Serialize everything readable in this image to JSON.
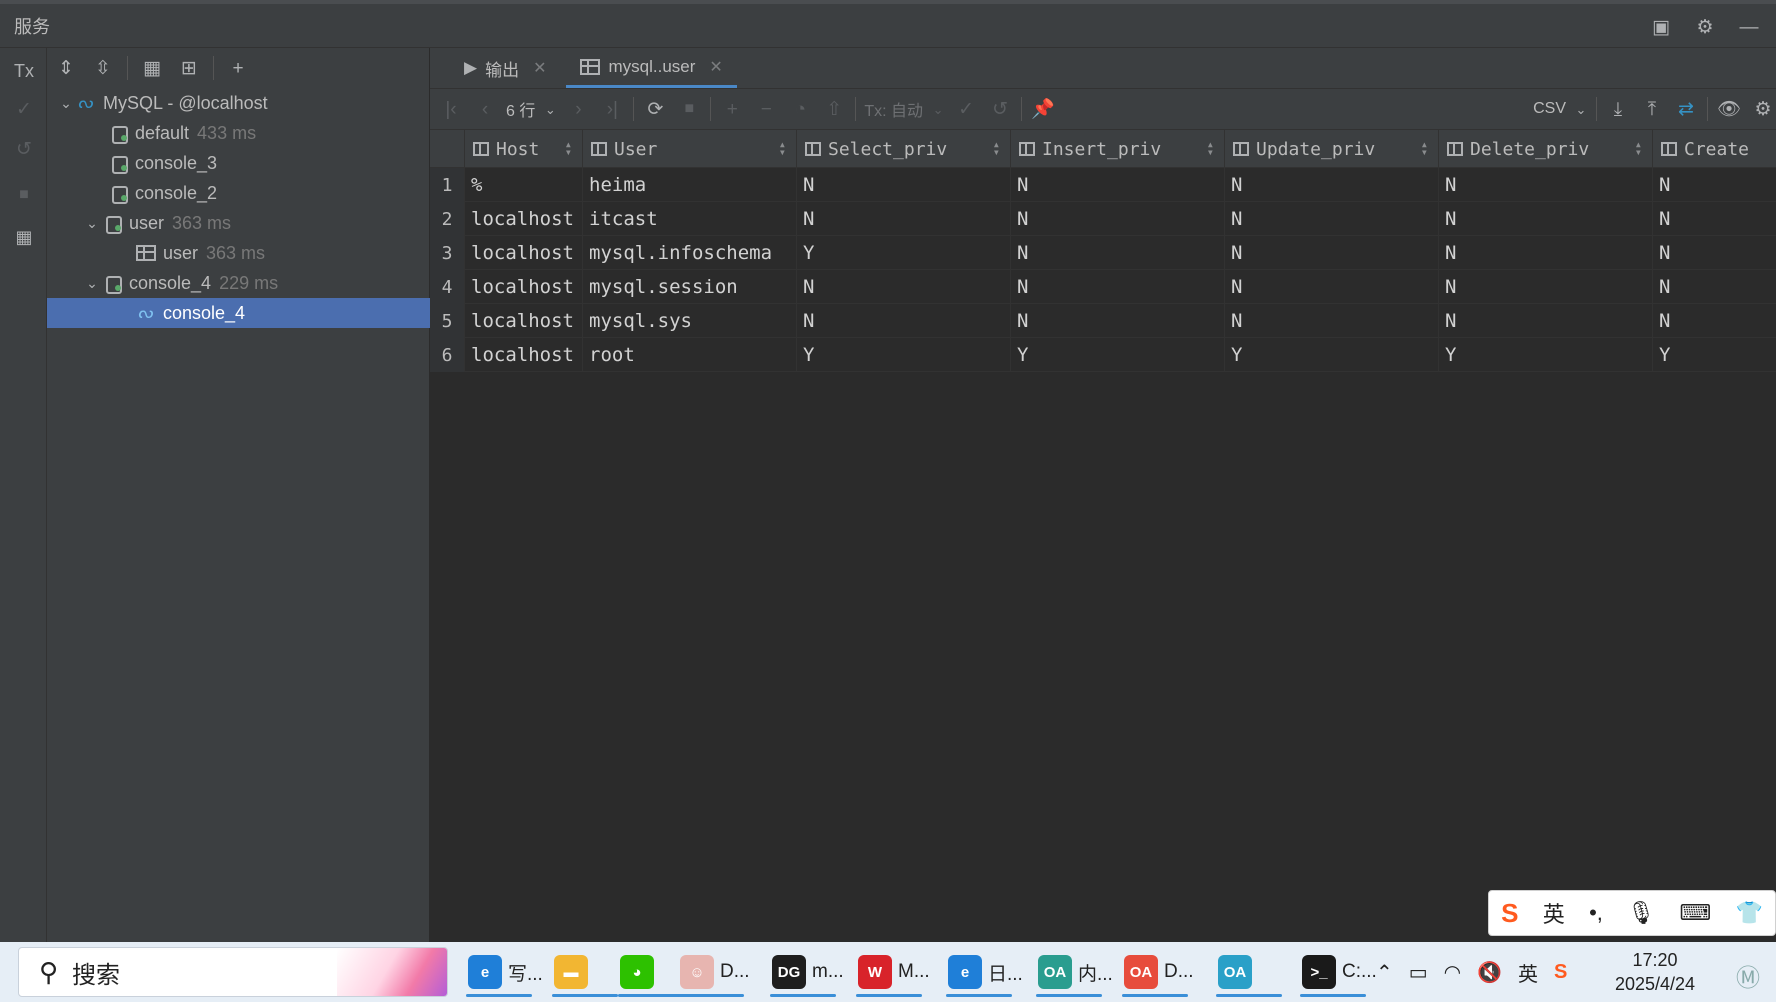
{
  "window": {
    "title": "服务"
  },
  "tree_toolbar": {
    "tx_label": "Tx"
  },
  "tree": [
    {
      "label": "MySQL - @localhost",
      "time": "",
      "icon": "mysql-dolphin-icon",
      "expanded": true
    },
    {
      "label": "default",
      "time": "433 ms",
      "icon": "session-icon"
    },
    {
      "label": "console_3",
      "time": "",
      "icon": "session-icon"
    },
    {
      "label": "console_2",
      "time": "",
      "icon": "session-icon"
    },
    {
      "label": "user",
      "time": "363 ms",
      "icon": "session-icon",
      "expanded": true
    },
    {
      "label": "user",
      "time": "363 ms",
      "icon": "table-icon"
    },
    {
      "label": "console_4",
      "time": "229 ms",
      "icon": "session-icon",
      "expanded": true
    },
    {
      "label": "console_4",
      "time": "",
      "icon": "mysql-dolphin-icon",
      "selected": true
    }
  ],
  "tabs": [
    {
      "label": "输出",
      "active": false
    },
    {
      "label": "mysql..user",
      "active": true
    }
  ],
  "grid_toolbar": {
    "rows_label": "6 行",
    "tx_mode": "Tx: 自动",
    "export_format": "CSV"
  },
  "columns": [
    "Host",
    "User",
    "Select_priv",
    "Insert_priv",
    "Update_priv",
    "Delete_priv",
    "Create"
  ],
  "rows": [
    {
      "num": "1",
      "cells": [
        "%",
        "heima",
        "N",
        "N",
        "N",
        "N",
        "N"
      ]
    },
    {
      "num": "2",
      "cells": [
        "localhost",
        "itcast",
        "N",
        "N",
        "N",
        "N",
        "N"
      ]
    },
    {
      "num": "3",
      "cells": [
        "localhost",
        "mysql.infoschema",
        "Y",
        "N",
        "N",
        "N",
        "N"
      ]
    },
    {
      "num": "4",
      "cells": [
        "localhost",
        "mysql.session",
        "N",
        "N",
        "N",
        "N",
        "N"
      ]
    },
    {
      "num": "5",
      "cells": [
        "localhost",
        "mysql.sys",
        "N",
        "N",
        "N",
        "N",
        "N"
      ]
    },
    {
      "num": "6",
      "cells": [
        "localhost",
        "root",
        "Y",
        "Y",
        "Y",
        "Y",
        "Y"
      ]
    }
  ],
  "ime": {
    "logo": "S",
    "lang": "英",
    "punct": "•,"
  },
  "taskbar": {
    "search_label": "搜索",
    "apps": [
      {
        "label": "写...",
        "icon": "edge-icon",
        "color": "#1f7fd8"
      },
      {
        "label": "",
        "icon": "folder-icon",
        "color": "#f2b632"
      },
      {
        "label": "",
        "icon": "wechat-icon",
        "color": "#2dc100"
      },
      {
        "label": "D...",
        "icon": "avatar-app-icon",
        "color": "#e7b5b0"
      },
      {
        "label": "m...",
        "icon": "datagrip-icon",
        "color": "#1e1e1e"
      },
      {
        "label": "M...",
        "icon": "wps-icon",
        "color": "#d8232a"
      },
      {
        "label": "日...",
        "icon": "edge-oa-icon",
        "color": "#1f7fd8"
      },
      {
        "label": "内...",
        "icon": "oa-icon",
        "color": "#2a9d8f"
      },
      {
        "label": "D...",
        "icon": "oa-doc-icon",
        "color": "#e74c3c"
      },
      {
        "label": "",
        "icon": "oa-app-icon",
        "color": "#2aa0c8"
      },
      {
        "label": "C:...",
        "icon": "terminal-icon",
        "color": "#1a1a1a"
      }
    ],
    "tray_lang": "英",
    "time": "17:20",
    "date": "2025/4/24"
  }
}
